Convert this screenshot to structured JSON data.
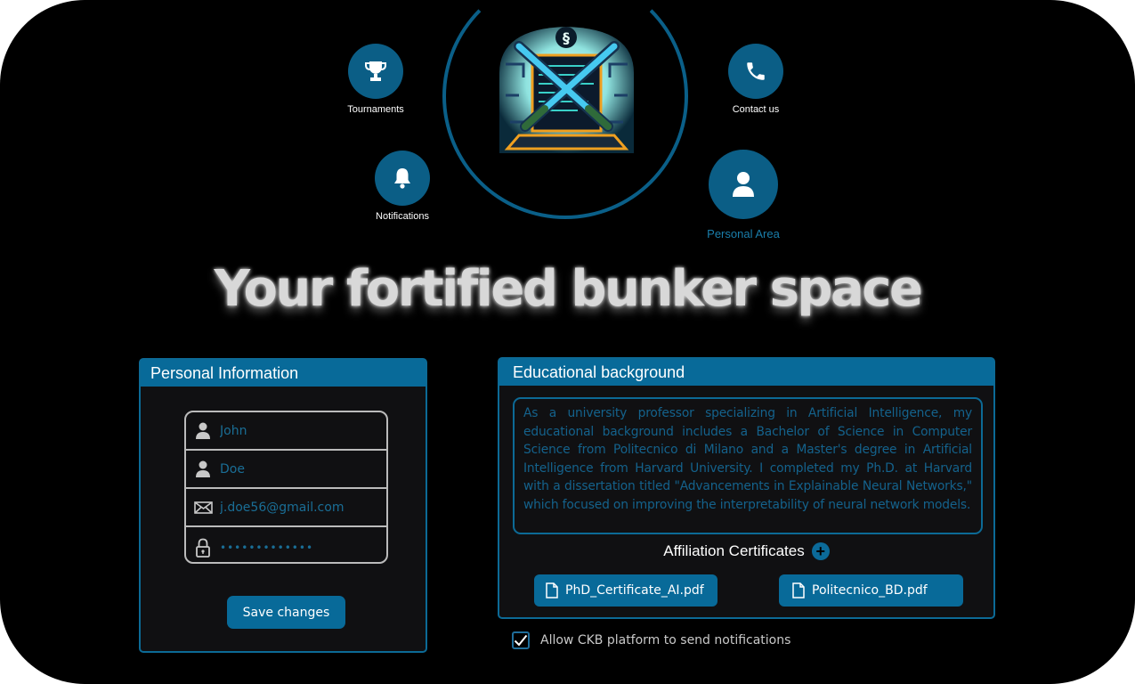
{
  "nav": {
    "tournaments": "Tournaments",
    "contact": "Contact us",
    "notifications": "Notifications",
    "personal_area": "Personal Area"
  },
  "title": "Your fortified bunker space",
  "personal": {
    "header": "Personal Information",
    "first_name": "John",
    "last_name": "Doe",
    "email": "j.doe56@gmail.com",
    "password": "•••••••••••••",
    "save_label": "Save changes"
  },
  "education": {
    "header": "Educational background",
    "text": "As a university professor specializing in Artificial Intelligence, my educational background includes a Bachelor of Science in Computer Science from Politecnico di Milano and a Master's degree in Artificial Intelligence from Harvard University. I completed my Ph.D. at Harvard with a dissertation titled \"Advancements in Explainable Neural Networks,\" which focused on improving the interpretability of neural network models.",
    "affiliation_label": "Affiliation Certificates",
    "add_symbol": "+",
    "certificates": [
      "PhD_Certificate_AI.pdf",
      "Politecnico_BD.pdf"
    ]
  },
  "notifications_consent": {
    "label": "Allow CKB platform to send notifications",
    "checked": true
  },
  "icons": {
    "tournaments": "trophy-icon",
    "contact": "phone-icon",
    "notifications": "bell-icon",
    "personal_area": "user-icon",
    "first_name": "user-icon",
    "last_name": "user-icon",
    "email": "mail-icon",
    "password": "lock-icon",
    "certificate": "file-icon",
    "checkbox": "checkmark-icon"
  },
  "colors": {
    "accent": "#086a99",
    "background": "#000000",
    "panel": "#101012",
    "text_accent": "#14628c"
  }
}
